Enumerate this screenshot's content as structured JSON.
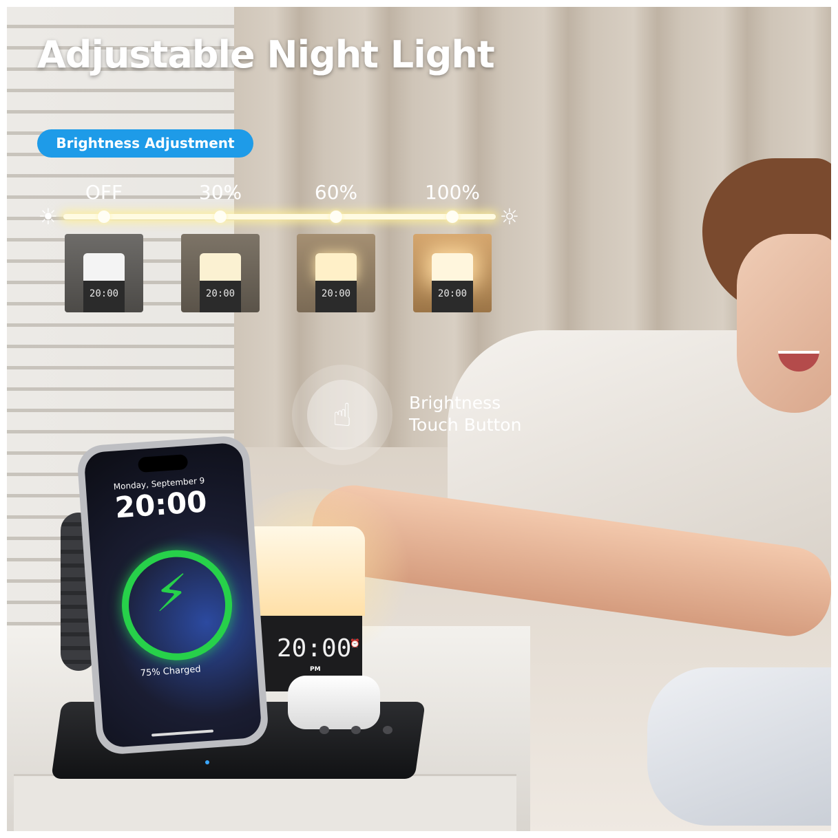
{
  "title": "Adjustable Night Light",
  "brightness_pill": "Brightness Adjustment",
  "levels": [
    "OFF",
    "30%",
    "60%",
    "100%"
  ],
  "thumb_clock": "20:00",
  "touch_button": {
    "line1": "Brightness",
    "line2": "Touch Button"
  },
  "phone": {
    "date": "Monday, September 9",
    "time": "20:00",
    "charge_status": "75% Charged"
  },
  "clock": {
    "time": "20:00",
    "meridiem": "PM"
  },
  "colors": {
    "accent": "#1e9be8",
    "charge_green": "#27d14a",
    "title_text": "#ffffff"
  },
  "icons": [
    "sun-dim-icon",
    "sun-bright-icon",
    "touch-hand-icon",
    "lightning-bolt-icon",
    "alarm-icon"
  ]
}
